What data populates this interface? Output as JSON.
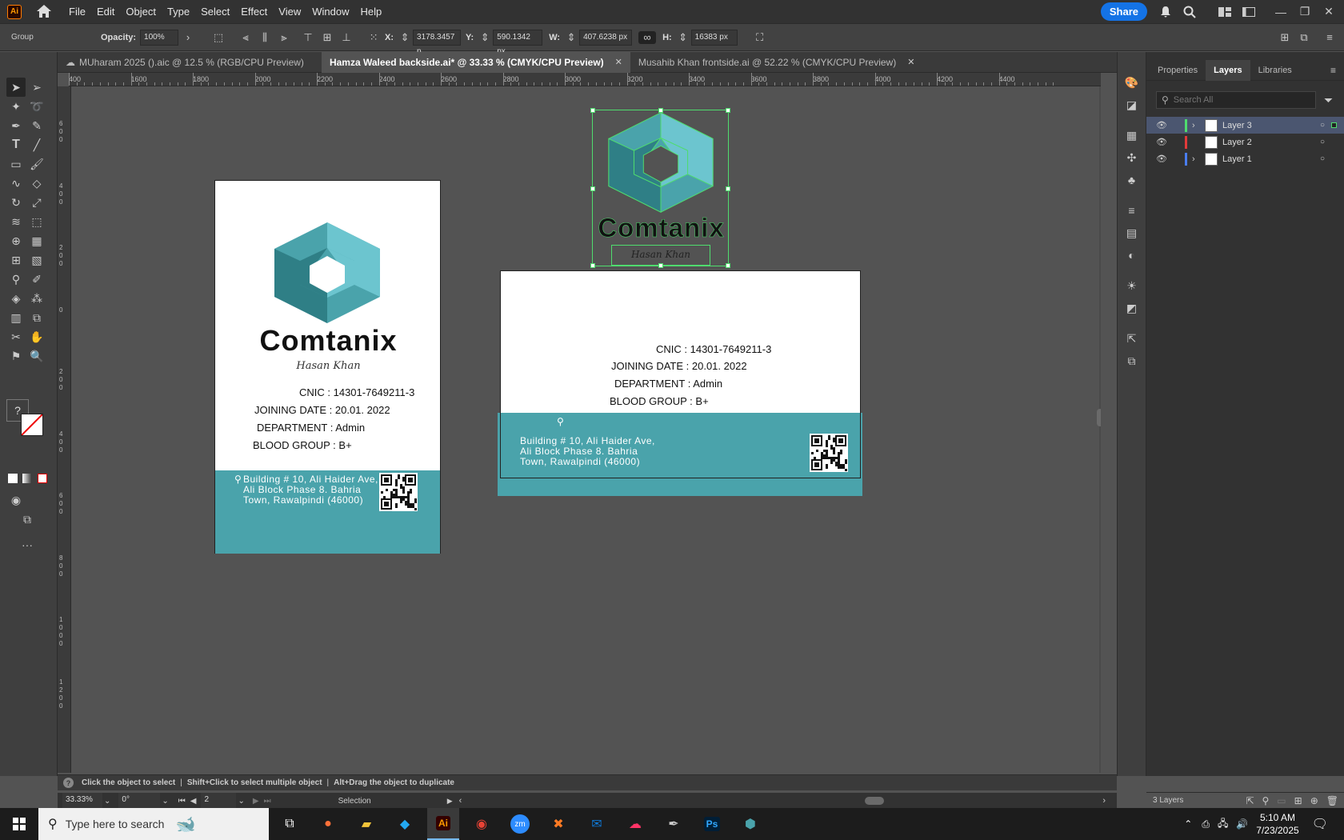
{
  "app": {
    "icon_label": "Ai"
  },
  "menu": {
    "items": [
      "File",
      "Edit",
      "Object",
      "Type",
      "Select",
      "Effect",
      "View",
      "Window",
      "Help"
    ],
    "share": "Share"
  },
  "control": {
    "selection": "Group",
    "opacity_label": "Opacity:",
    "opacity": "100%",
    "x_label": "X:",
    "x": "3178.3457 p",
    "y_label": "Y:",
    "y": "590.1342 px",
    "w_label": "W:",
    "w": "407.6238 px",
    "h_label": "H:",
    "h": "16383 px"
  },
  "tabs": [
    {
      "label": "MUharam 2025 ().aic @ 12.5 % (RGB/CPU Preview)"
    },
    {
      "label": "Hamza Waleed backside.ai* @ 33.33 % (CMYK/CPU Preview)"
    },
    {
      "label": "Musahib Khan  frontside.ai @ 52.22 % (CMYK/CPU Preview)"
    }
  ],
  "ruler_h": [
    "400",
    "1600",
    "1800",
    "2000",
    "2200",
    "2400",
    "2600",
    "2800",
    "3000",
    "3200",
    "3400",
    "3600",
    "3800",
    "4000",
    "4200",
    "4400"
  ],
  "ruler_v": [
    "6\n0\n0",
    "4\n0\n0",
    "2\n0\n0",
    "0",
    "2\n0\n0",
    "4\n0\n0",
    "6\n0\n0",
    "8\n0\n0",
    "1\n0\n0\n0",
    "1\n2\n0\n0"
  ],
  "card": {
    "brand": "Comtanix",
    "signature": "Hasan Khan",
    "cnic": "CNIC : 14301-7649211-3",
    "joining": "JOINING DATE : 20.01. 2022",
    "department": "DEPARTMENT : Admin",
    "blood": "BLOOD GROUP : B+",
    "addr1": "Building # 10, Ali Haider Ave,",
    "addr2": "Ali Block Phase 8. Bahria",
    "addr3": "Town, Rawalpindi (46000)",
    "teal": "#4aa3ab",
    "logo_dark": "#2f7f86",
    "logo_mid": "#4aa3ab",
    "logo_light": "#6cc5cf"
  },
  "panel": {
    "tabs": [
      "Properties",
      "Layers",
      "Libraries"
    ],
    "search_placeholder": "Search All",
    "layers": [
      {
        "name": "Layer 3",
        "color": "#4fdc6e"
      },
      {
        "name": "Layer 2",
        "color": "#e23b3b"
      },
      {
        "name": "Layer 1",
        "color": "#4a7df0"
      }
    ],
    "footer": "3 Layers"
  },
  "status": {
    "hint1": "Click the object to select",
    "hint2": "Shift+Click to select multiple object",
    "hint3": "Alt+Drag the object to duplicate",
    "zoom": "33.33%",
    "rotate": "0°",
    "artboard": "2",
    "mode": "Selection"
  },
  "taskbar": {
    "search": "Type here to search",
    "time": "5:10 AM",
    "date": "7/23/2025"
  }
}
